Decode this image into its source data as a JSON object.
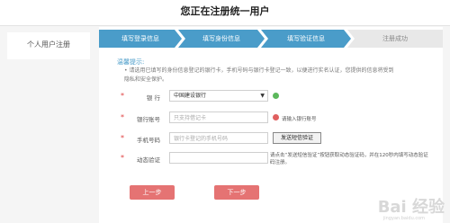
{
  "header": {
    "title": "您正在注册统一用户"
  },
  "sidebar": {
    "items": [
      {
        "label": "个人用户注册"
      }
    ]
  },
  "steps": [
    {
      "label": "填写登录信息"
    },
    {
      "label": "填写身份信息"
    },
    {
      "label": "填写验证信息"
    },
    {
      "label": "注册成功"
    }
  ],
  "tip": {
    "title": "温馨提示:",
    "text": "• 请选用已填写的身份信息登记的银行卡，手机号码与银行卡登记一致，以便进行实名认证，您提供的信息将受到隐私和安全保护。"
  },
  "form": {
    "bank": {
      "label": "银 行",
      "value": "中国建设银行"
    },
    "account": {
      "label": "银行账号",
      "placeholder": "只支持借记卡",
      "hint": "请输入银行账号"
    },
    "phone": {
      "label": "手机号码",
      "placeholder": "银行卡登记的手机号码",
      "send_label": "发送短信验证"
    },
    "code": {
      "label": "动态验证",
      "hint": "请点击“发送短信验证”按钮获取动态验证码，并在120秒内填写动态验证码注册。"
    }
  },
  "buttons": {
    "prev": "上一步",
    "next": "下一步"
  },
  "watermark": {
    "text": "Bai 经验",
    "sub": "jingyan.baidu.com"
  },
  "colors": {
    "step_active": "#4a9cc9",
    "button": "#e57373",
    "required": "#e04040"
  }
}
